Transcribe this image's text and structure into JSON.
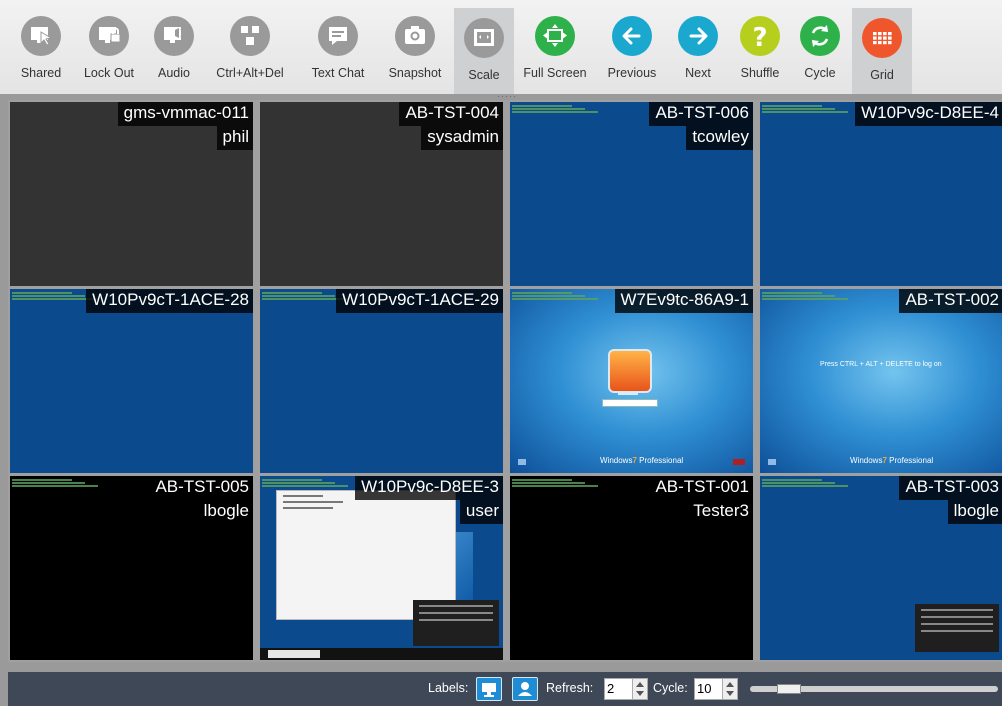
{
  "toolbar": {
    "buttons": [
      {
        "label": "Shared",
        "icon": "shared-icon",
        "color": "#9a9a9a"
      },
      {
        "label": "Lock Out",
        "icon": "lock-out-icon",
        "color": "#9a9a9a"
      },
      {
        "label": "Audio",
        "icon": "audio-icon",
        "color": "#9a9a9a"
      },
      {
        "label": "Ctrl+Alt+Del",
        "icon": "ctrl-alt-del-icon",
        "color": "#9a9a9a"
      },
      {
        "label": "Text Chat",
        "icon": "text-chat-icon",
        "color": "#9a9a9a"
      },
      {
        "label": "Snapshot",
        "icon": "snapshot-icon",
        "color": "#9a9a9a"
      },
      {
        "label": "Scale",
        "icon": "scale-icon",
        "color": "#9a9a9a",
        "active": true
      },
      {
        "label": "Full Screen",
        "icon": "full-screen-icon",
        "color": "#2eb14a"
      },
      {
        "label": "Previous",
        "icon": "previous-icon",
        "color": "#1ba8cf"
      },
      {
        "label": "Next",
        "icon": "next-icon",
        "color": "#1ba8cf"
      },
      {
        "label": "Shuffle",
        "icon": "shuffle-icon",
        "color": "#b6cf1f"
      },
      {
        "label": "Cycle",
        "icon": "cycle-icon",
        "color": "#2eb14a"
      },
      {
        "label": "Grid",
        "icon": "grid-icon",
        "color": "#f0562b",
        "active": true
      }
    ]
  },
  "tiles": [
    {
      "host": "gms-vmmac-011",
      "user": "phil",
      "screen": "dark"
    },
    {
      "host": "AB-TST-004",
      "user": "sysadmin",
      "screen": "dark"
    },
    {
      "host": "AB-TST-006",
      "user": "tcowley",
      "screen": "blue"
    },
    {
      "host": "W10Pv9c-D8EE-4",
      "user": "",
      "screen": "blue"
    },
    {
      "host": "W10Pv9cT-1ACE-28",
      "user": "",
      "screen": "blue"
    },
    {
      "host": "W10Pv9cT-1ACE-29",
      "user": "",
      "screen": "blue"
    },
    {
      "host": "W7Ev9tc-86A9-1",
      "user": "",
      "screen": "win7-login"
    },
    {
      "host": "AB-TST-002",
      "user": "",
      "screen": "win7-cad"
    },
    {
      "host": "AB-TST-005",
      "user": "lbogle",
      "screen": "black"
    },
    {
      "host": "W10Pv9c-D8EE-3",
      "user": "user",
      "screen": "win10"
    },
    {
      "host": "AB-TST-001",
      "user": "Tester3",
      "screen": "black"
    },
    {
      "host": "AB-TST-003",
      "user": "lbogle",
      "screen": "blue-defender"
    }
  ],
  "win7": {
    "logo_text": "Windows",
    "logo_num": "7",
    "edition": "Professional",
    "cad_text": "Press CTRL + ALT + DELETE to log on"
  },
  "footer": {
    "labels_text": "Labels:",
    "refresh_text": "Refresh:",
    "refresh_value": "2",
    "cycle_text": "Cycle:",
    "cycle_value": "10",
    "slider_level": 0.12
  }
}
